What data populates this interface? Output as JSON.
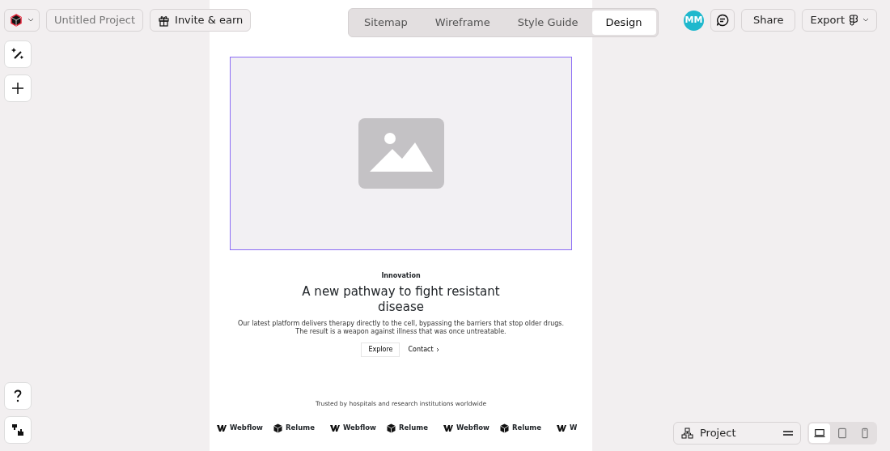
{
  "toolbar": {
    "project_name": "Untitled Project",
    "invite": "Invite & earn"
  },
  "tabs": [
    {
      "label": "Sitemap",
      "selected": false
    },
    {
      "label": "Wireframe",
      "selected": false
    },
    {
      "label": "Style Guide",
      "selected": false
    },
    {
      "label": "Design",
      "selected": true
    }
  ],
  "user": {
    "initials": "MM"
  },
  "actions": {
    "share": "Share",
    "export": "Export"
  },
  "hero": {
    "eyebrow": "Innovation",
    "heading": "A new pathway to fight resistant disease",
    "body": "Our latest platform delivers therapy directly to the cell, bypassing the barriers that stop older drugs. The result is a weapon against illness that was once untreatable.",
    "buttons": [
      {
        "label": "Explore",
        "kind": "secondary"
      },
      {
        "label": "Contact",
        "kind": "link"
      }
    ]
  },
  "logos": {
    "caption": "Trusted by hospitals and research institutions worldwide",
    "items": [
      {
        "name": "Webflow",
        "kind": "webflow"
      },
      {
        "name": "Relume",
        "kind": "relume"
      },
      {
        "name": "Webflow",
        "kind": "webflow"
      },
      {
        "name": "Relume",
        "kind": "relume"
      },
      {
        "name": "Webflow",
        "kind": "webflow"
      },
      {
        "name": "Relume",
        "kind": "relume"
      },
      {
        "name": "W",
        "kind": "webflow"
      }
    ]
  },
  "bottom": {
    "layers": "Project",
    "devices": [
      {
        "kind": "desktop",
        "selected": true
      },
      {
        "kind": "tablet",
        "selected": false
      },
      {
        "kind": "phone",
        "selected": false
      }
    ]
  }
}
